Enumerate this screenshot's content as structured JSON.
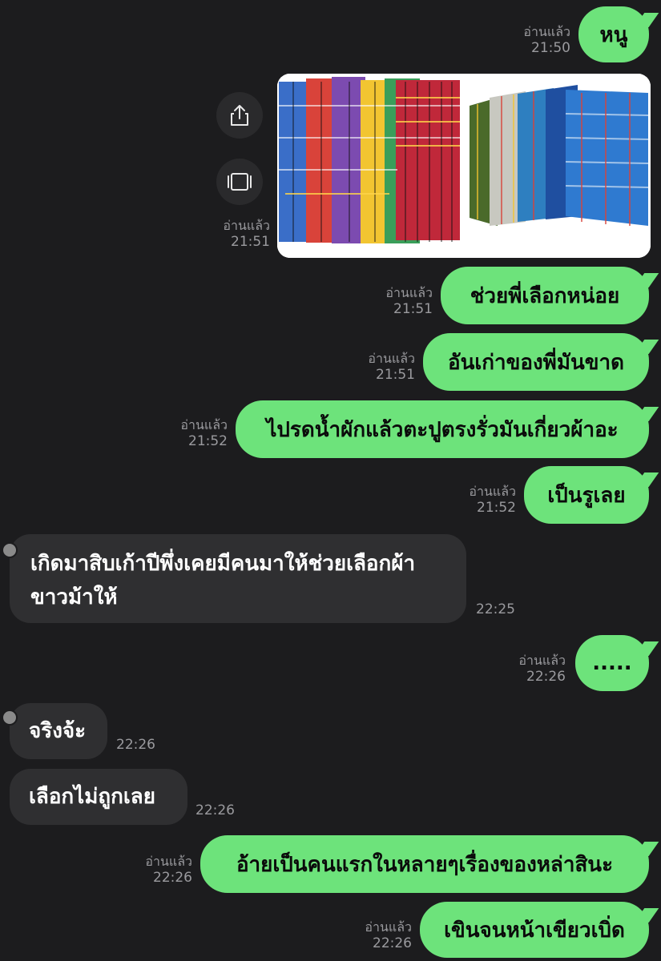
{
  "messages": [
    {
      "side": "out",
      "text": "หนู",
      "read": "อ่านแล้ว",
      "time": "21:50"
    },
    {
      "side": "out",
      "type": "images",
      "read": "อ่านแล้ว",
      "time": "21:51",
      "images": [
        "plaid-cloth-photo",
        "plaid-cloth-photo"
      ]
    },
    {
      "side": "out",
      "text": "ช่วยพี่เลือกหน่อย",
      "read": "อ่านแล้ว",
      "time": "21:51"
    },
    {
      "side": "out",
      "text": "อันเก่าของพี่มันขาด",
      "read": "อ่านแล้ว",
      "time": "21:51"
    },
    {
      "side": "out",
      "text": "ไปรดน้ำผักแล้วตะปูตรงรั่วมันเกี่ยวผ้าอะ",
      "read": "อ่านแล้ว",
      "time": "21:52"
    },
    {
      "side": "out",
      "text": "เป็นรูเลย",
      "read": "อ่านแล้ว",
      "time": "21:52"
    },
    {
      "side": "in",
      "text_line1": "เกิดมาสิบเก้าปีพึ่งเคยมีคนมาให้ช่วยเลือกผ้า",
      "text_line2": "ขาวม้าให้",
      "time": "22:25"
    },
    {
      "side": "out",
      "text": ".....",
      "read": "อ่านแล้ว",
      "time": "22:26"
    },
    {
      "side": "in",
      "text": "จริงจ้ะ",
      "time": "22:26"
    },
    {
      "side": "in",
      "text": "เลือกไม่ถูกเลย",
      "time": "22:26"
    },
    {
      "side": "out",
      "text": "อ้ายเป็นคนแรกในหลายๆเรื่องของหล่าสินะ",
      "read": "อ่านแล้ว",
      "time": "22:26"
    },
    {
      "side": "out",
      "text": "เขินจนหน้าเขียวเบิ่ด",
      "read": "อ่านแล้ว",
      "time": "22:26"
    }
  ],
  "image_actions": [
    "share-icon",
    "fullscreen-icon"
  ],
  "colors": {
    "background": "#1c1c1e",
    "out_bubble": "#6de37b",
    "in_bubble": "#2f2f31",
    "meta": "#9a9a9e"
  }
}
